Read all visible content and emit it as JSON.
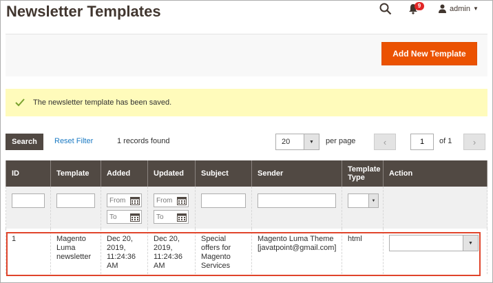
{
  "header": {
    "title": "Newsletter Templates",
    "notifications_count": "9",
    "user_label": "admin"
  },
  "actions": {
    "add_new_label": "Add New Template"
  },
  "message": {
    "text": "The newsletter template has been saved."
  },
  "toolbar": {
    "search_label": "Search",
    "reset_label": "Reset Filter",
    "records_text": "1 records found",
    "per_page_value": "20",
    "per_page_label": "per page",
    "page_value": "1",
    "page_of": "of 1"
  },
  "grid": {
    "columns": [
      "ID",
      "Template",
      "Added",
      "Updated",
      "Subject",
      "Sender",
      "Template Type",
      "Action"
    ],
    "filters": {
      "from_placeholder": "From",
      "to_placeholder": "To"
    },
    "rows": [
      {
        "id": "1",
        "template": "Magento Luma newsletter",
        "added": "Dec 20, 2019, 11:24:36 AM",
        "updated": "Dec 20, 2019, 11:24:36 AM",
        "subject": "Special offers for Magento Services",
        "sender": "Magento Luma Theme [javatpoint@gmail.com]",
        "type": "html"
      }
    ]
  },
  "colors": {
    "accent": "#eb5202",
    "header_bg": "#514943",
    "message_bg": "#fffbbb",
    "link": "#1979c3",
    "highlight": "#e0442a"
  }
}
